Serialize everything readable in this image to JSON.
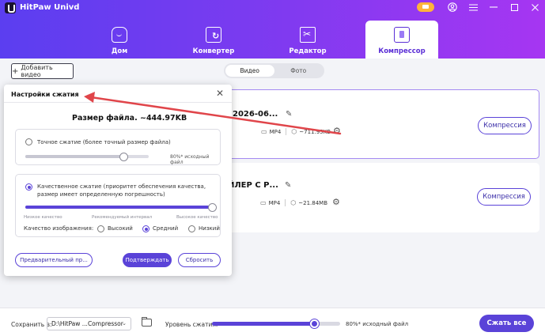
{
  "app": {
    "title": "HitPaw Univd"
  },
  "header_icons": [
    "premium-icon",
    "user-icon",
    "menu-icon",
    "minimize-icon",
    "maximize-icon",
    "close-icon"
  ],
  "tabs": [
    {
      "label": "Дом",
      "icon": "home-icon"
    },
    {
      "label": "Конвертер",
      "icon": "convert-icon"
    },
    {
      "label": "Редактор",
      "icon": "editor-icon"
    },
    {
      "label": "Компрессор",
      "icon": "compressor-icon",
      "active": true
    }
  ],
  "toolbar": {
    "add_label": "Добавить видео",
    "seg_video": "Видео",
    "seg_photo": "Фото"
  },
  "files": [
    {
      "name": "_2026-06...",
      "format": "MP4",
      "size": "~711.95KB",
      "compress_label": "Компрессия"
    },
    {
      "name": "ЙЛЕР С Р...",
      "format": "MP4",
      "size": "~21.84MB",
      "compress_label": "Компрессия"
    }
  ],
  "bottom": {
    "save_label": "Сохранить в:",
    "path": "D:\\HitPaw ...Compressor",
    "level_label": "Уровень сжатия.",
    "level_value": 0.8,
    "level_text": "80%* исходный файл",
    "compress_all": "Сжать все"
  },
  "dialog": {
    "title": "Настройки сжатия",
    "file_size": "Размер файла.  ~444.97KB",
    "exact_label": "Точное сжатие (более точный размер файла)",
    "exact_value": 0.8,
    "exact_pct": "80%* исходный файл",
    "quality_label": "Качественное сжатие (приоритет обеспечения качества, размер имеет определенную погрешность)",
    "quality_value": 1.0,
    "low_q": "Низкое качество",
    "rec_range": "Рекомендуемый интервал",
    "high_q": "Высокое качество",
    "img_quality": "Качество изображения:",
    "options": [
      "Высокий",
      "Средний",
      "Низкий"
    ],
    "selected_option": "Средний",
    "preview_btn": "Предварительный пр...",
    "confirm_btn": "Подтверждать",
    "reset_btn": "Сбросить"
  },
  "colors": {
    "accent": "#5a43d8",
    "header_start": "#5b3ef0",
    "header_end": "#a636f2",
    "arrow": "#e0454a"
  }
}
